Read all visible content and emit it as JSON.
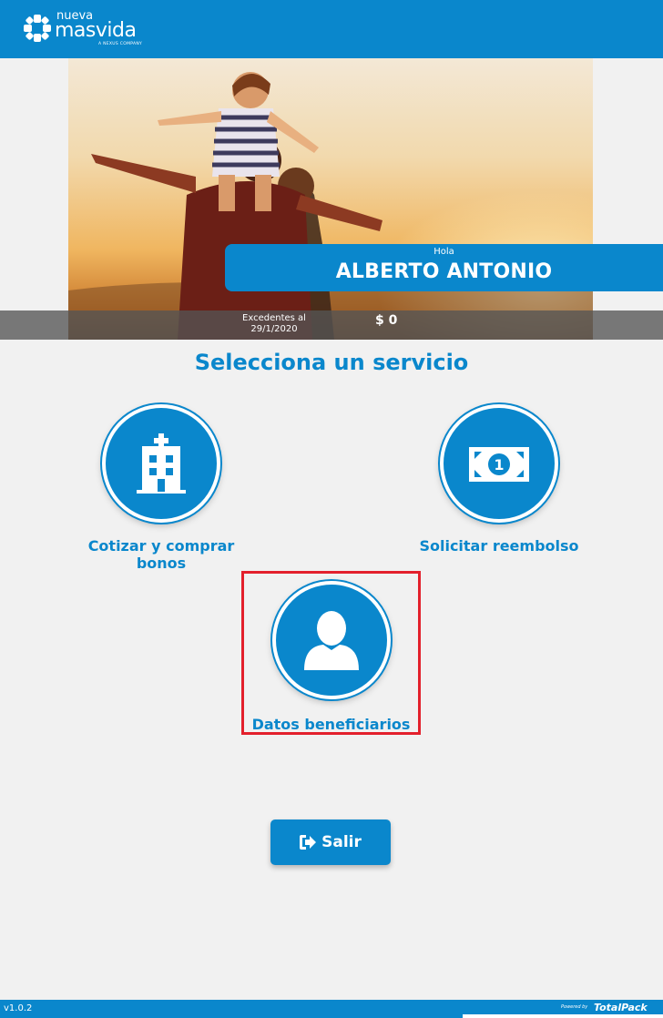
{
  "header": {
    "logo": {
      "small_text": "nueva",
      "main_text": "masvida",
      "tagline": "A NEXUS COMPANY"
    }
  },
  "hero": {
    "greeting": "Hola",
    "user_name": "ALBERTO ANTONIO",
    "excess_label": "Excedentes al 29/1/2020",
    "excess_amount": "$ 0"
  },
  "main": {
    "title": "Selecciona un servicio",
    "services": [
      {
        "label": "Cotizar y comprar bonos",
        "icon": "hospital-icon"
      },
      {
        "label": "Solicitar reembolso",
        "icon": "money-icon"
      },
      {
        "label": "Datos beneficiarios",
        "icon": "user-icon",
        "highlighted": true
      }
    ],
    "exit_button": {
      "label": "Salir",
      "icon": "sign-out-icon"
    }
  },
  "footer": {
    "version": "v1.0.2",
    "powered_by": "Powered by",
    "brand": "TotalPack"
  },
  "colors": {
    "primary": "#0a87cc",
    "highlight_border": "#e3202c",
    "background": "#f1f1f1"
  }
}
